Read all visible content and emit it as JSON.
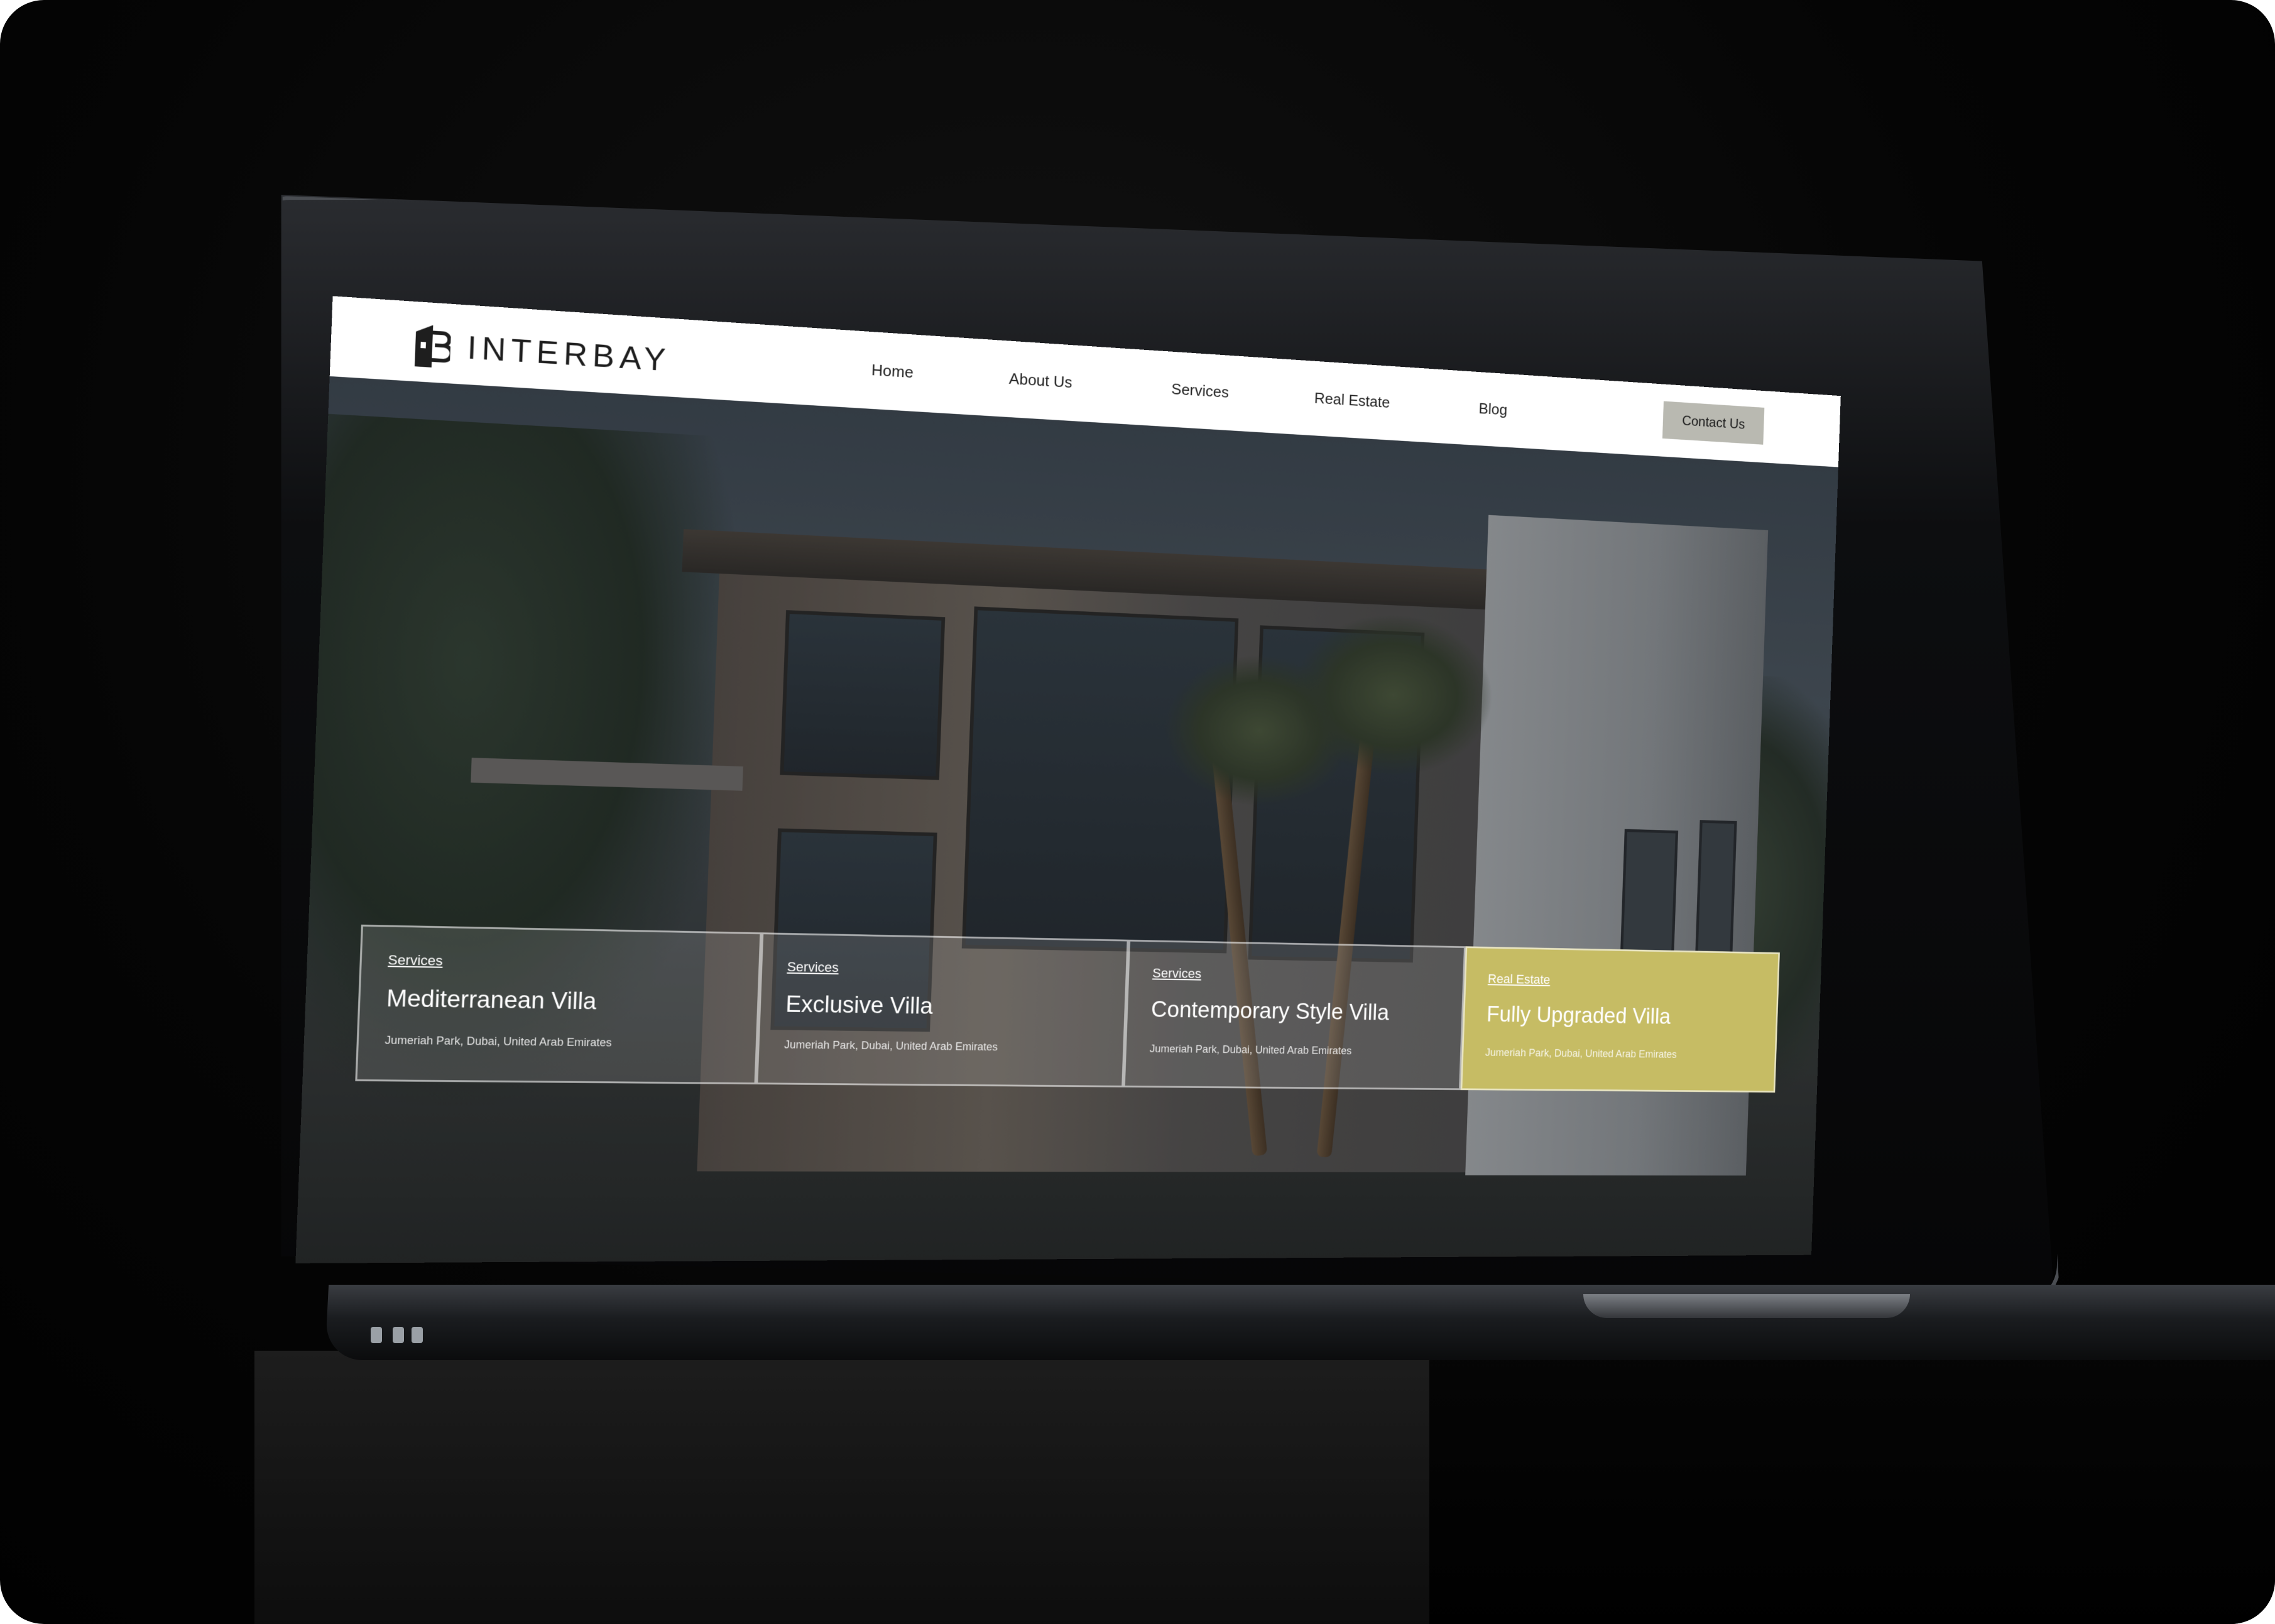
{
  "brand": {
    "name": "INTERBAY"
  },
  "nav": {
    "items": [
      {
        "label": "Home"
      },
      {
        "label": "About Us"
      },
      {
        "label": "Services"
      },
      {
        "label": "Real Estate"
      },
      {
        "label": "Blog"
      }
    ],
    "contact_label": "Contact Us"
  },
  "colors": {
    "accent": "#c6bc64",
    "contact_button": "#b9b9b1",
    "background": "#000000"
  },
  "cards": [
    {
      "category": "Services",
      "title": "Mediterranean Villa",
      "location": "Jumeriah Park, Dubai, United Arab Emirates"
    },
    {
      "category": "Services",
      "title": "Exclusive Villa",
      "location": "Jumeriah Park, Dubai, United Arab Emirates"
    },
    {
      "category": "Services",
      "title": "Contemporary Style Villa",
      "location": "Jumeriah Park, Dubai, United Arab Emirates"
    },
    {
      "category": "Real Estate",
      "title": "Fully Upgraded Villa",
      "location": "Jumeriah Park, Dubai, United Arab Emirates"
    }
  ]
}
